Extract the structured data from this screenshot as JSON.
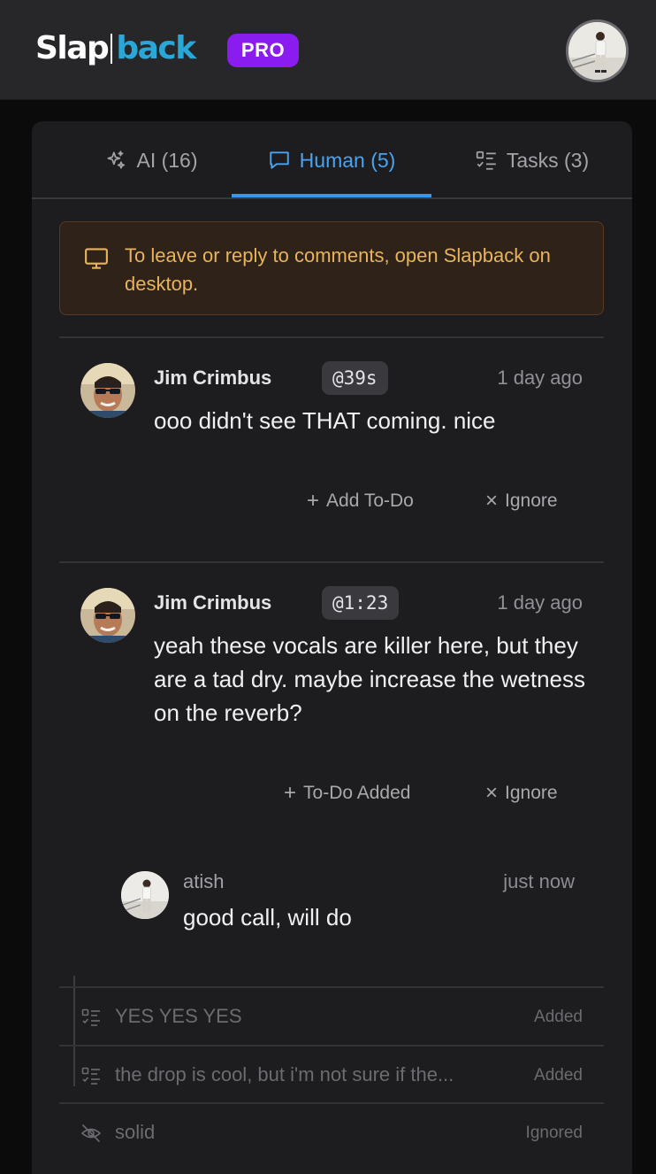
{
  "header": {
    "logo_part1": "Slap",
    "logo_part2": "back",
    "plan_badge": "PRO"
  },
  "tabs": [
    {
      "label": "AI (16)",
      "icon": "sparkles-icon",
      "active": false
    },
    {
      "label": "Human (5)",
      "icon": "chat-bubble-icon",
      "active": true
    },
    {
      "label": "Tasks (3)",
      "icon": "task-list-icon",
      "active": false
    }
  ],
  "notice": {
    "icon": "monitor-icon",
    "text": "To leave or reply to comments, open Slapback on desktop."
  },
  "comments": [
    {
      "author": "Jim Crimbus",
      "timestamp": "@39s",
      "time_ago": "1 day ago",
      "text": "ooo didn't see THAT coming. nice",
      "primary_action": "Add To-Do",
      "secondary_action": "Ignore"
    },
    {
      "author": "Jim Crimbus",
      "timestamp": "@1:23",
      "time_ago": "1 day ago",
      "text": "yeah these vocals are killer here, but they are a tad dry. maybe increase the wetness on the reverb?",
      "primary_action": "To-Do Added",
      "secondary_action": "Ignore",
      "reply": {
        "author": "atish",
        "time_ago": "just now",
        "text": "good call, will do"
      }
    }
  ],
  "collapsed": [
    {
      "icon": "task-list-icon",
      "text": "YES YES YES",
      "status": "Added"
    },
    {
      "icon": "task-list-icon",
      "text": "the drop is cool, but i'm not sure if the...",
      "status": "Added"
    },
    {
      "icon": "eye-off-icon",
      "text": "solid",
      "status": "Ignored"
    }
  ],
  "colors": {
    "accent_blue": "#4aa3ee",
    "pro_purple": "#8a1cf0",
    "notice_amber": "#e8b45b"
  }
}
